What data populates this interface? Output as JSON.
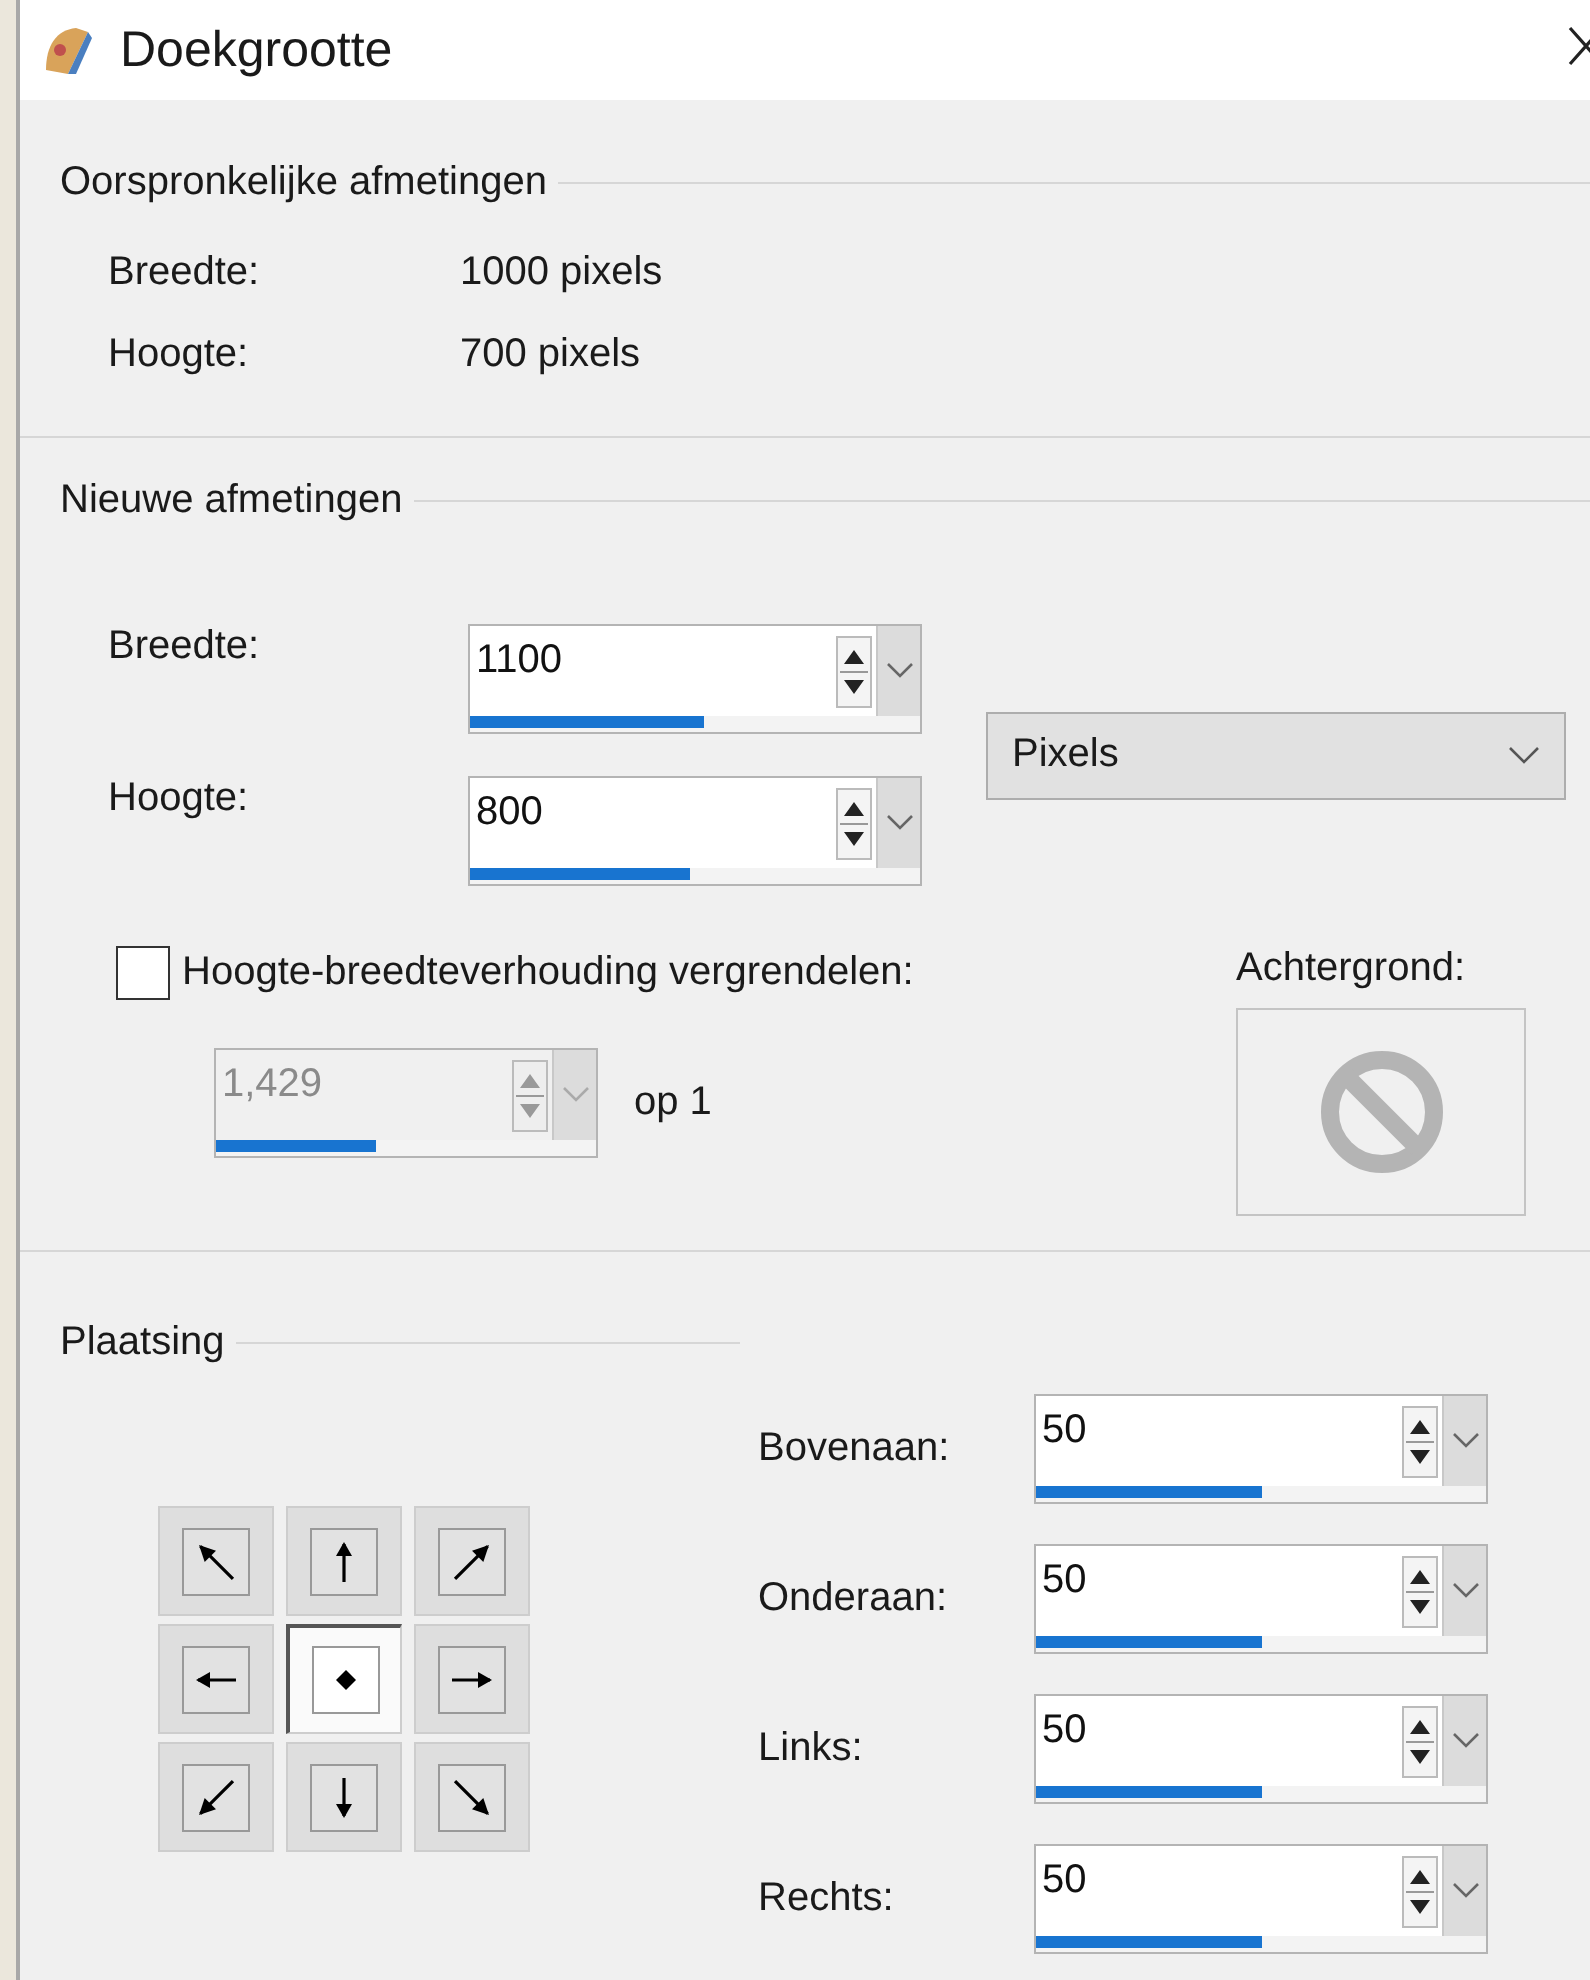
{
  "window": {
    "title": "Doekgrootte"
  },
  "original": {
    "title": "Oorspronkelijke afmetingen",
    "rows": [
      {
        "label": "Breedte:",
        "value": "1000 pixels"
      },
      {
        "label": "Hoogte:",
        "value": "700 pixels"
      }
    ]
  },
  "new": {
    "title": "Nieuwe afmetingen",
    "fields": [
      {
        "label": "Breedte:",
        "value": "1100",
        "level": 0.52,
        "disabled": false
      },
      {
        "label": "Hoogte:",
        "value": "800",
        "level": 0.49,
        "disabled": false
      }
    ],
    "unit": {
      "value": "Pixels"
    },
    "lock": {
      "label": "Hoogte-breedteverhouding vergrendelen:",
      "checked": false
    },
    "ratio": {
      "value": "1,429",
      "level": 0.42,
      "disabled": true,
      "suffix": "op 1"
    },
    "background": {
      "label": "Achtergrond:"
    }
  },
  "placement": {
    "title": "Plaatsing",
    "anchors": [
      {
        "kind": "nw",
        "selected": false
      },
      {
        "kind": "n",
        "selected": false
      },
      {
        "kind": "ne",
        "selected": false
      },
      {
        "kind": "w",
        "selected": false
      },
      {
        "kind": "center",
        "selected": true
      },
      {
        "kind": "e",
        "selected": false
      },
      {
        "kind": "sw",
        "selected": false
      },
      {
        "kind": "s",
        "selected": false
      },
      {
        "kind": "se",
        "selected": false
      }
    ],
    "margins": [
      {
        "label": "Bovenaan:",
        "value": "50",
        "level": 0.5,
        "disabled": false
      },
      {
        "label": "Onderaan:",
        "value": "50",
        "level": 0.5,
        "disabled": false
      },
      {
        "label": "Links:",
        "value": "50",
        "level": 0.5,
        "disabled": false
      },
      {
        "label": "Rechts:",
        "value": "50",
        "level": 0.5,
        "disabled": false
      }
    ]
  }
}
